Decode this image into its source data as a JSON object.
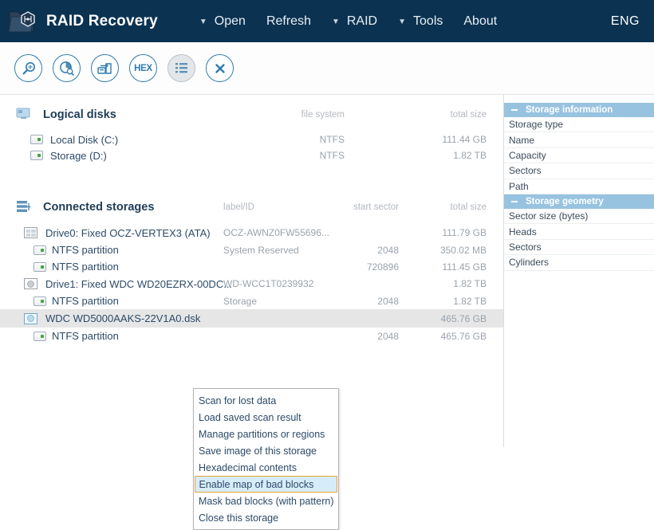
{
  "header": {
    "app_title": "RAID Recovery",
    "logo_icon": "raid-folder-logo",
    "menu": [
      {
        "label": "Open",
        "has_caret": true,
        "caret_icon": "chevron-down-icon"
      },
      {
        "label": "Refresh",
        "has_caret": false,
        "caret_icon": ""
      },
      {
        "label": "RAID",
        "has_caret": true,
        "caret_icon": "chevron-down-icon"
      },
      {
        "label": "Tools",
        "has_caret": true,
        "caret_icon": "chevron-down-icon"
      },
      {
        "label": "About",
        "has_caret": false,
        "caret_icon": ""
      }
    ],
    "language": "ENG",
    "bg_color": "#0b3251"
  },
  "toolbar": {
    "buttons": [
      {
        "name": "scan-for-lost-data-icon",
        "glyph": "magnifier",
        "label": ""
      },
      {
        "name": "disk-analysis-icon",
        "glyph": "pie-disk",
        "label": ""
      },
      {
        "name": "save-image-icon",
        "glyph": "save-disk",
        "label": ""
      },
      {
        "name": "hexadecimal-icon",
        "glyph": "hex",
        "label": "HEX"
      },
      {
        "name": "list-view-icon",
        "glyph": "list",
        "label": ""
      },
      {
        "name": "close-storage-icon",
        "glyph": "close",
        "label": ""
      }
    ],
    "accent_color": "#2e7bb0"
  },
  "logical_disks": {
    "title": "Logical disks",
    "icon": "monitor-icon",
    "columns": {
      "file_system": "file system",
      "total_size": "total size"
    },
    "rows": [
      {
        "icon": "logical-disk-icon",
        "name": "Local Disk (C:)",
        "file_system": "NTFS",
        "total_size": "111.44 GB"
      },
      {
        "icon": "logical-disk-icon",
        "name": "Storage (D:)",
        "file_system": "NTFS",
        "total_size": "1.82 TB"
      }
    ]
  },
  "connected_storages": {
    "title": "Connected storages",
    "icon": "storage-stack-icon",
    "columns": {
      "label_id": "label/ID",
      "start_sector": "start sector",
      "total_size": "total size"
    },
    "rows": [
      {
        "icon": "ssd-grid-icon",
        "indent": 0,
        "name": "Drive0: Fixed OCZ-VERTEX3 (ATA)",
        "label_id": "OCZ-AWNZ0FW55696...",
        "start_sector": "",
        "total_size": "111.79 GB",
        "selected": false
      },
      {
        "icon": "partition-icon",
        "indent": 1,
        "name": "NTFS partition",
        "label_id": "System Reserved",
        "start_sector": "2048",
        "total_size": "350.02 MB",
        "selected": false
      },
      {
        "icon": "partition-icon",
        "indent": 1,
        "name": "NTFS partition",
        "label_id": "",
        "start_sector": "720896",
        "total_size": "111.45 GB",
        "selected": false
      },
      {
        "icon": "hdd-platter-icon",
        "indent": 0,
        "name": "Drive1: Fixed WDC WD20EZRX-00DC...",
        "label_id": "WD-WCC1T0239932",
        "start_sector": "",
        "total_size": "1.82 TB",
        "selected": false
      },
      {
        "icon": "partition-icon",
        "indent": 1,
        "name": "NTFS partition",
        "label_id": "Storage",
        "start_sector": "2048",
        "total_size": "1.82 TB",
        "selected": false
      },
      {
        "icon": "disk-image-icon",
        "indent": 0,
        "name": "WDC WD5000AAKS-22V1A0.dsk",
        "label_id": "",
        "start_sector": "",
        "total_size": "465.76 GB",
        "selected": true
      },
      {
        "icon": "partition-icon",
        "indent": 1,
        "name": "NTFS partition",
        "label_id": "",
        "start_sector": "2048",
        "total_size": "465.76 GB",
        "selected": false
      }
    ]
  },
  "context_menu": {
    "items": [
      {
        "label": "Scan for lost data",
        "active": false
      },
      {
        "label": "Load saved scan result",
        "active": false
      },
      {
        "label": "Manage partitions or regions",
        "active": false
      },
      {
        "label": "Save image of this storage",
        "active": false
      },
      {
        "label": "Hexadecimal contents",
        "active": false
      },
      {
        "label": "Enable map of bad blocks",
        "active": true
      },
      {
        "label": "Mask bad blocks (with pattern)",
        "active": false
      },
      {
        "label": "Close this storage",
        "active": false
      }
    ],
    "highlight_border_color": "#e8a33d",
    "highlight_bg_color": "#d7ecf9"
  },
  "sidebar": {
    "header_bg_color": "#97c3e0",
    "sections": [
      {
        "title": "Storage information",
        "collapse_icon": "minus-icon",
        "rows": [
          "Storage type",
          "Name",
          "Capacity",
          "Sectors",
          "Path"
        ]
      },
      {
        "title": "Storage geometry",
        "collapse_icon": "minus-icon",
        "rows": [
          "Sector size (bytes)",
          "Heads",
          "Sectors",
          "Cylinders"
        ]
      }
    ]
  }
}
